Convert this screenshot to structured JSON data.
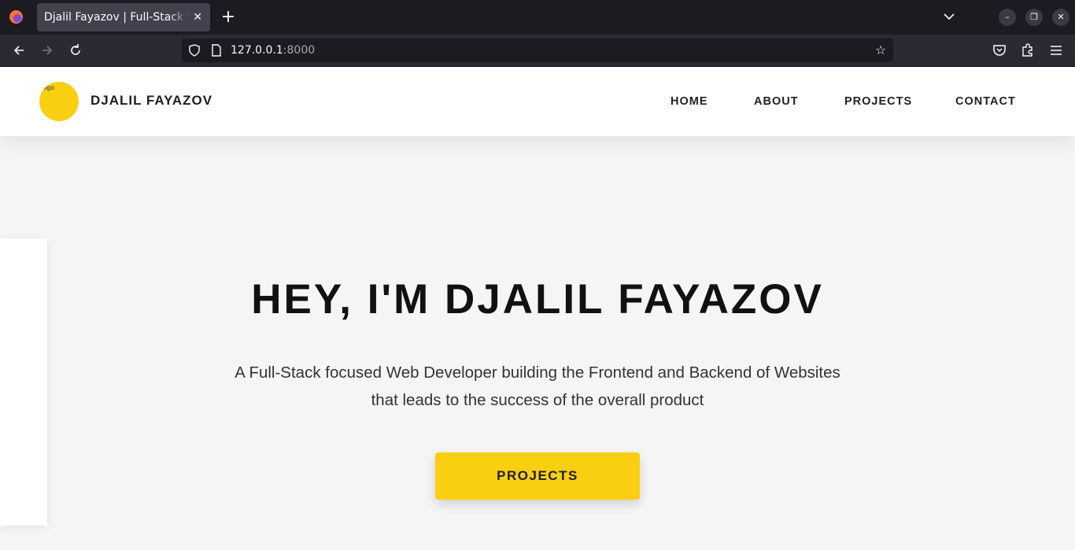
{
  "browser": {
    "tab_title": "Djalil Fayazov | Full-Stack Web Developer",
    "tab_close": "✕",
    "new_tab": "+",
    "url_host": "127.0.0.1",
    "url_port": ":8000",
    "window_controls": {
      "minimize": "–",
      "restore": "❐",
      "close": "✕"
    },
    "icons": [
      "firefox-logo",
      "back-arrow",
      "forward-arrow",
      "reload",
      "shield",
      "page",
      "bookmark-star",
      "pocket",
      "extensions",
      "menu"
    ]
  },
  "site": {
    "logo_alt": "logo",
    "brand": "DJALIL FAYAZOV",
    "nav": [
      "HOME",
      "ABOUT",
      "PROJECTS",
      "CONTACT"
    ],
    "accent_color": "#f9cf12"
  },
  "hero": {
    "title": "HEY, I'M DJALIL FAYAZOV",
    "subtitle_line1": "A Full-Stack focused Web Developer building the Frontend and Backend of Websites",
    "subtitle_line2": "that leads to the success of the overall product",
    "cta_label": "PROJECTS"
  }
}
